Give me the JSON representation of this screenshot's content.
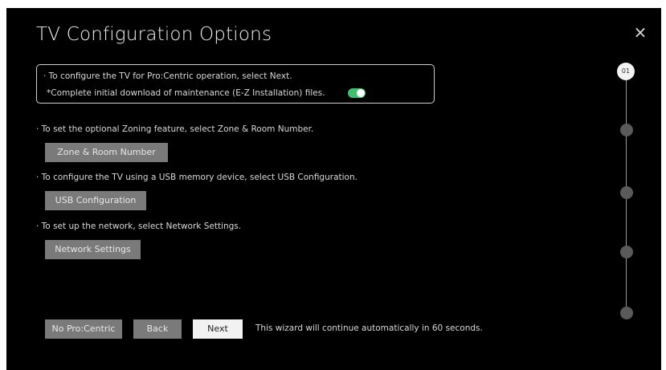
{
  "window": {
    "title": "TV Configuration Options",
    "close_label": "×"
  },
  "intro": {
    "line1": "· To configure the TV for Pro:Centric operation, select Next.",
    "line2": "*Complete initial download of maintenance (E-Z Installation) files.",
    "toggle_on": true
  },
  "sections": {
    "zoning_text": "· To set the optional Zoning feature, select Zone & Room Number.",
    "zoning_button": "Zone & Room Number",
    "usb_text": "· To configure the TV using a USB memory device, select USB Configuration.",
    "usb_button": "USB Configuration",
    "network_text": "· To set up the network, select Network Settings.",
    "network_button": "Network Settings"
  },
  "footer": {
    "no_procentric": "No Pro:Centric",
    "back": "Back",
    "next": "Next",
    "auto_text": "This wizard will continue automatically in 60 seconds."
  },
  "stepper": {
    "active_label": "01",
    "total_steps": 5,
    "current_step": 1
  },
  "colors": {
    "background": "#000000",
    "toggle_on": "#3fbf6f",
    "button": "#7a7a7a",
    "primary_button": "#f2f2f2"
  }
}
